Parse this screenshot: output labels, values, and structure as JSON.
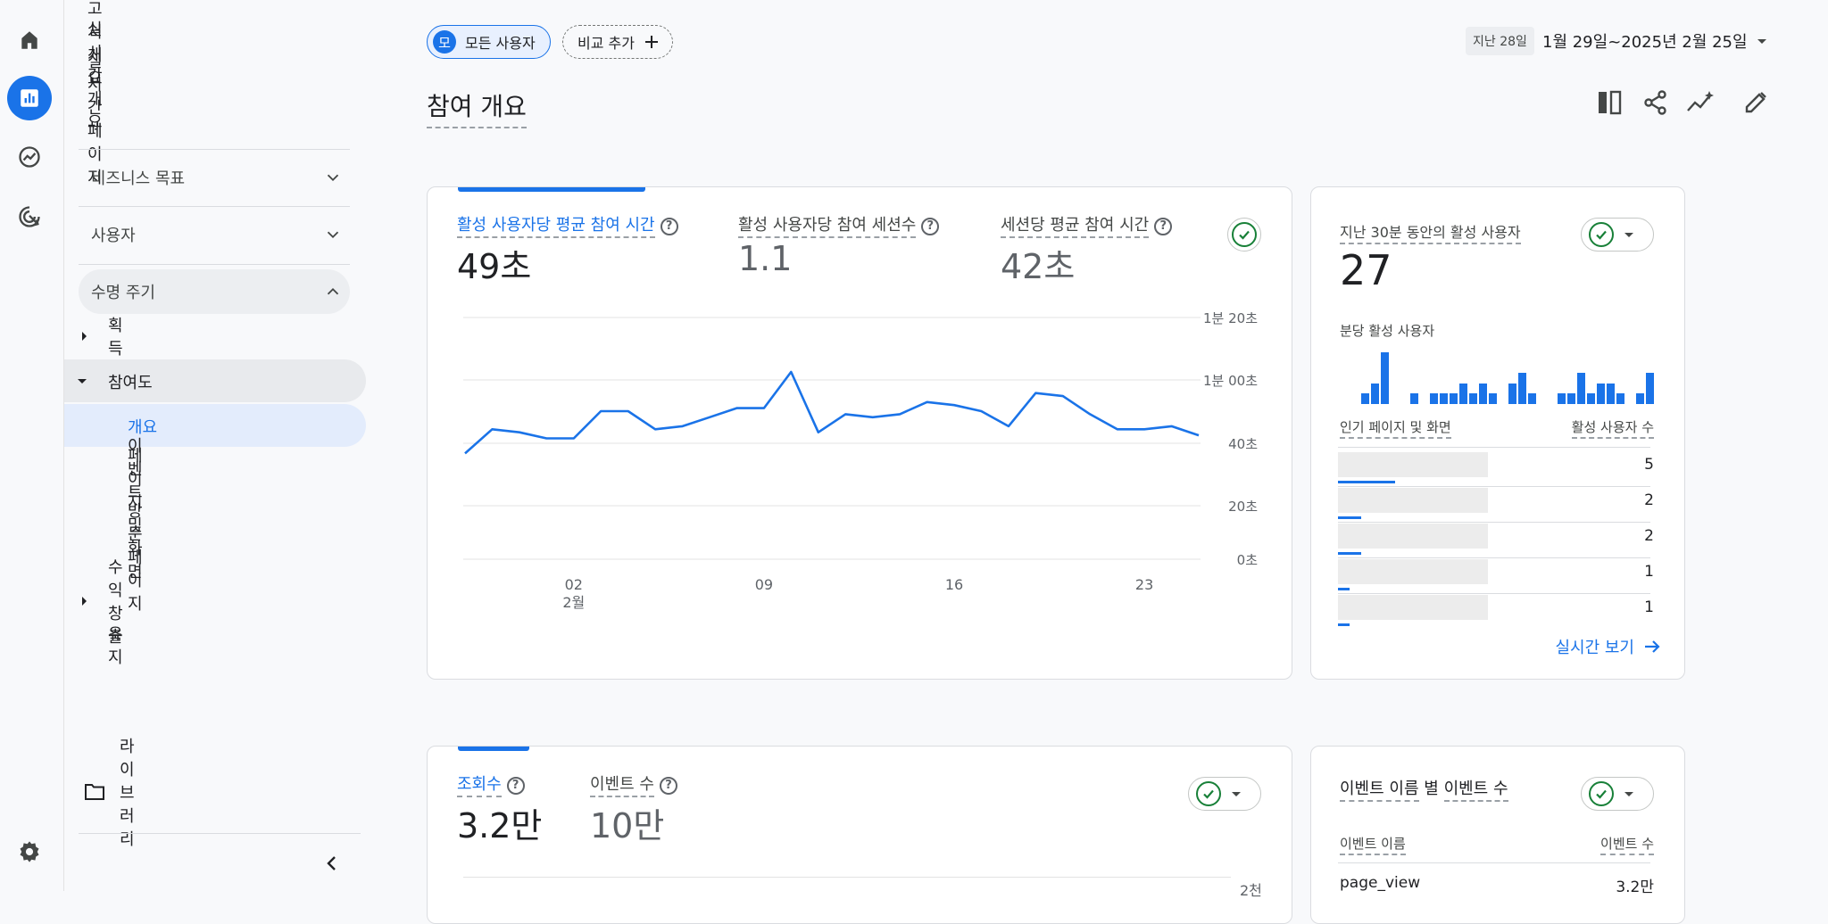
{
  "nav": {
    "items": [
      "보고서 개요",
      "실시간 개요",
      "실시간 페이지"
    ],
    "sections": [
      "비즈니스 목표",
      "사용자",
      "수명 주기"
    ],
    "lifecycle": {
      "acquisition": "획득",
      "engagement": "참여도",
      "engagement_children": [
        "개요",
        "이벤트",
        "페이지 및 화면",
        "방문 페이지"
      ],
      "monetization": "수익 창출",
      "retention": "유지"
    },
    "library": "라이브러리"
  },
  "topbar": {
    "segment_avatar": "모",
    "segment_label": "모든 사용자",
    "compare_label": "비교 추가",
    "date_badge": "지난 28일",
    "date_range": "1월 29일~2025년 2월 25일"
  },
  "page": {
    "title": "참여 개요"
  },
  "engagement_card": {
    "metrics": [
      {
        "label": "활성 사용자당 평균 참여 시간",
        "value": "49초"
      },
      {
        "label": "활성 사용자당 참여 세션수",
        "value": "1.1"
      },
      {
        "label": "세션당 평균 참여 시간",
        "value": "42초"
      }
    ],
    "chart_data": {
      "type": "line",
      "x_ticks": [
        "02",
        "09",
        "16",
        "23"
      ],
      "x_month_label": "2월",
      "y_ticks": [
        "1분 20초",
        "1분 00초",
        "40초",
        "20초",
        "0초"
      ],
      "ylim": [
        0,
        80
      ],
      "series": [
        {
          "values": [
            35,
            43,
            42,
            40,
            40,
            49,
            49,
            43,
            44,
            47,
            50,
            50,
            62,
            42,
            48,
            47,
            48,
            52,
            51,
            49,
            44,
            55,
            54,
            48,
            43,
            43,
            44,
            41
          ]
        }
      ],
      "color": "#1a73e8"
    }
  },
  "realtime_card": {
    "title": "지난 30분 동안의 활성 사용자",
    "value": "27",
    "sub_label": "분당 활성 사용자",
    "bars": [
      0,
      0,
      1,
      2,
      5,
      0,
      0,
      1,
      0,
      1,
      1,
      1,
      2,
      1,
      2,
      1,
      0,
      2,
      3,
      1,
      0,
      0,
      1,
      1,
      3,
      1,
      2,
      2,
      1,
      0,
      1,
      3
    ],
    "table_header_left": "인기 페이지 및 화면",
    "table_header_right": "활성 사용자 수",
    "rows": [
      5,
      2,
      2,
      1,
      1
    ],
    "link_label": "실시간 보기"
  },
  "views_card": {
    "metrics": [
      {
        "label": "조회수",
        "value": "3.2만"
      },
      {
        "label": "이벤트 수",
        "value": "10만"
      }
    ],
    "y_tick_top": "2천"
  },
  "events_card": {
    "title_part1": "이벤트 이름",
    "title_part2": "별",
    "title_part3": "이벤트 수",
    "header_left": "이벤트 이름",
    "header_right": "이벤트 수",
    "row_name": "page_view",
    "row_value": "3.2만"
  },
  "colors": {
    "accent": "#1a73e8",
    "check": "#188038"
  }
}
